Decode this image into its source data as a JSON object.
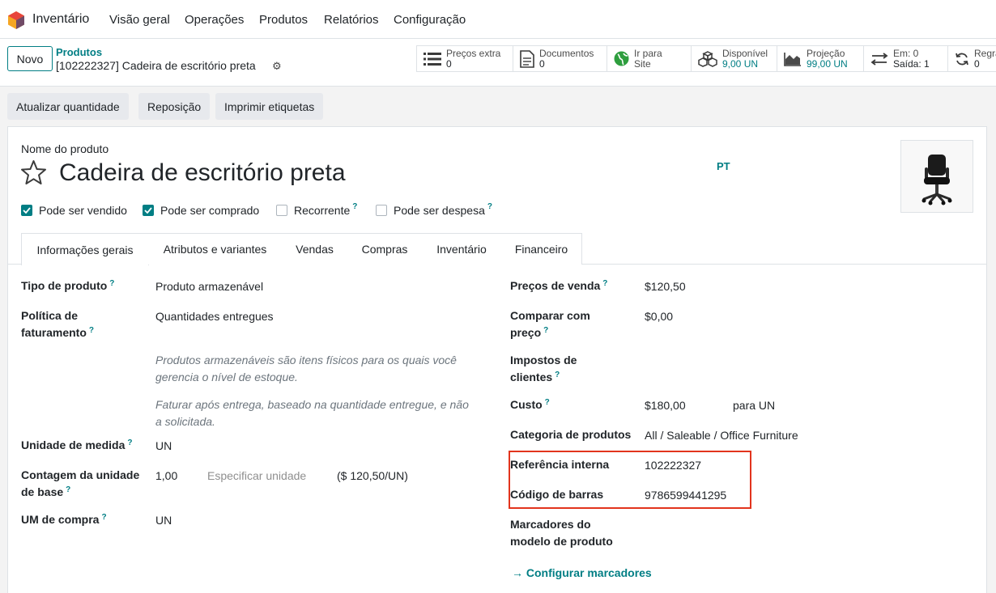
{
  "app": {
    "name": "Inventário"
  },
  "nav": {
    "overview": "Visão geral",
    "operations": "Operações",
    "products": "Produtos",
    "reports": "Relatórios",
    "configuration": "Configuração"
  },
  "control": {
    "new_label": "Novo",
    "breadcrumb": "Produtos",
    "record_title": "[102222327] Cadeira de escritório preta"
  },
  "smart_buttons": {
    "extra_prices": {
      "label": "Preços extra",
      "value": "0"
    },
    "documents": {
      "label": "Documentos",
      "value": "0"
    },
    "website": {
      "line1": "Ir para",
      "line2": "Site"
    },
    "available": {
      "label": "Disponível",
      "value": "9,00 UN"
    },
    "forecast": {
      "label": "Projeção",
      "value": "99,00 UN"
    },
    "moves": {
      "in": "Em: 0",
      "out": "Saída: 1"
    },
    "rules": {
      "label": "Regra",
      "value": "0"
    }
  },
  "actions": {
    "update_qty": "Atualizar quantidade",
    "replenish": "Reposição",
    "print_labels": "Imprimir etiquetas"
  },
  "form": {
    "name_label": "Nome do produto",
    "name": "Cadeira de escritório preta",
    "lang": "PT",
    "checks": {
      "can_sell": {
        "label": "Pode ser vendido",
        "checked": true
      },
      "can_buy": {
        "label": "Pode ser comprado",
        "checked": true
      },
      "recurring": {
        "label": "Recorrente",
        "checked": false
      },
      "expense": {
        "label": "Pode ser despesa",
        "checked": false
      }
    },
    "help_mark": "?"
  },
  "tabs": [
    "Informações gerais",
    "Atributos e variantes",
    "Vendas",
    "Compras",
    "Inventário",
    "Financeiro"
  ],
  "general": {
    "product_type": {
      "label": "Tipo de produto",
      "value": "Produto armazenável"
    },
    "invoice_policy": {
      "label1": "Política de",
      "label2": "faturamento",
      "value": "Quantidades entregues"
    },
    "help1a": "Produtos armazenáveis são itens físicos para os quais você",
    "help1b": "gerencia o nível de estoque.",
    "help2a": "Faturar após entrega, baseado na quantidade entregue, e não",
    "help2b": "a solicitada.",
    "uom": {
      "label": "Unidade de medida",
      "value": "UN"
    },
    "uom_count": {
      "label1": "Contagem da unidade",
      "label2": "de base",
      "value": "1,00",
      "placeholder": "Especificar unidade",
      "price": "($ 120,50/UN)"
    },
    "purchase_uom": {
      "label": "UM de compra",
      "value": "UN"
    },
    "sales_price": {
      "label": "Preços de venda",
      "value": "$120,50"
    },
    "compare_price": {
      "label1": "Comparar com",
      "label2": "preço",
      "value": "$0,00"
    },
    "customer_taxes": {
      "label1": "Impostos de",
      "label2": "clientes"
    },
    "cost": {
      "label": "Custo",
      "value": "$180,00",
      "per": "para UN"
    },
    "category": {
      "label": "Categoria de produtos",
      "value": "All / Saleable / Office Furniture"
    },
    "internal_ref": {
      "label": "Referência interna",
      "value": "102222327"
    },
    "barcode": {
      "label": "Código de barras",
      "value": "9786599441295"
    },
    "tags": {
      "label1": "Marcadores do",
      "label2": "modelo de produto"
    },
    "configure_tags": "Configurar marcadores"
  },
  "colors": {
    "accent": "#017e84",
    "highlight": "#e2341d",
    "brand": "#714b67"
  }
}
